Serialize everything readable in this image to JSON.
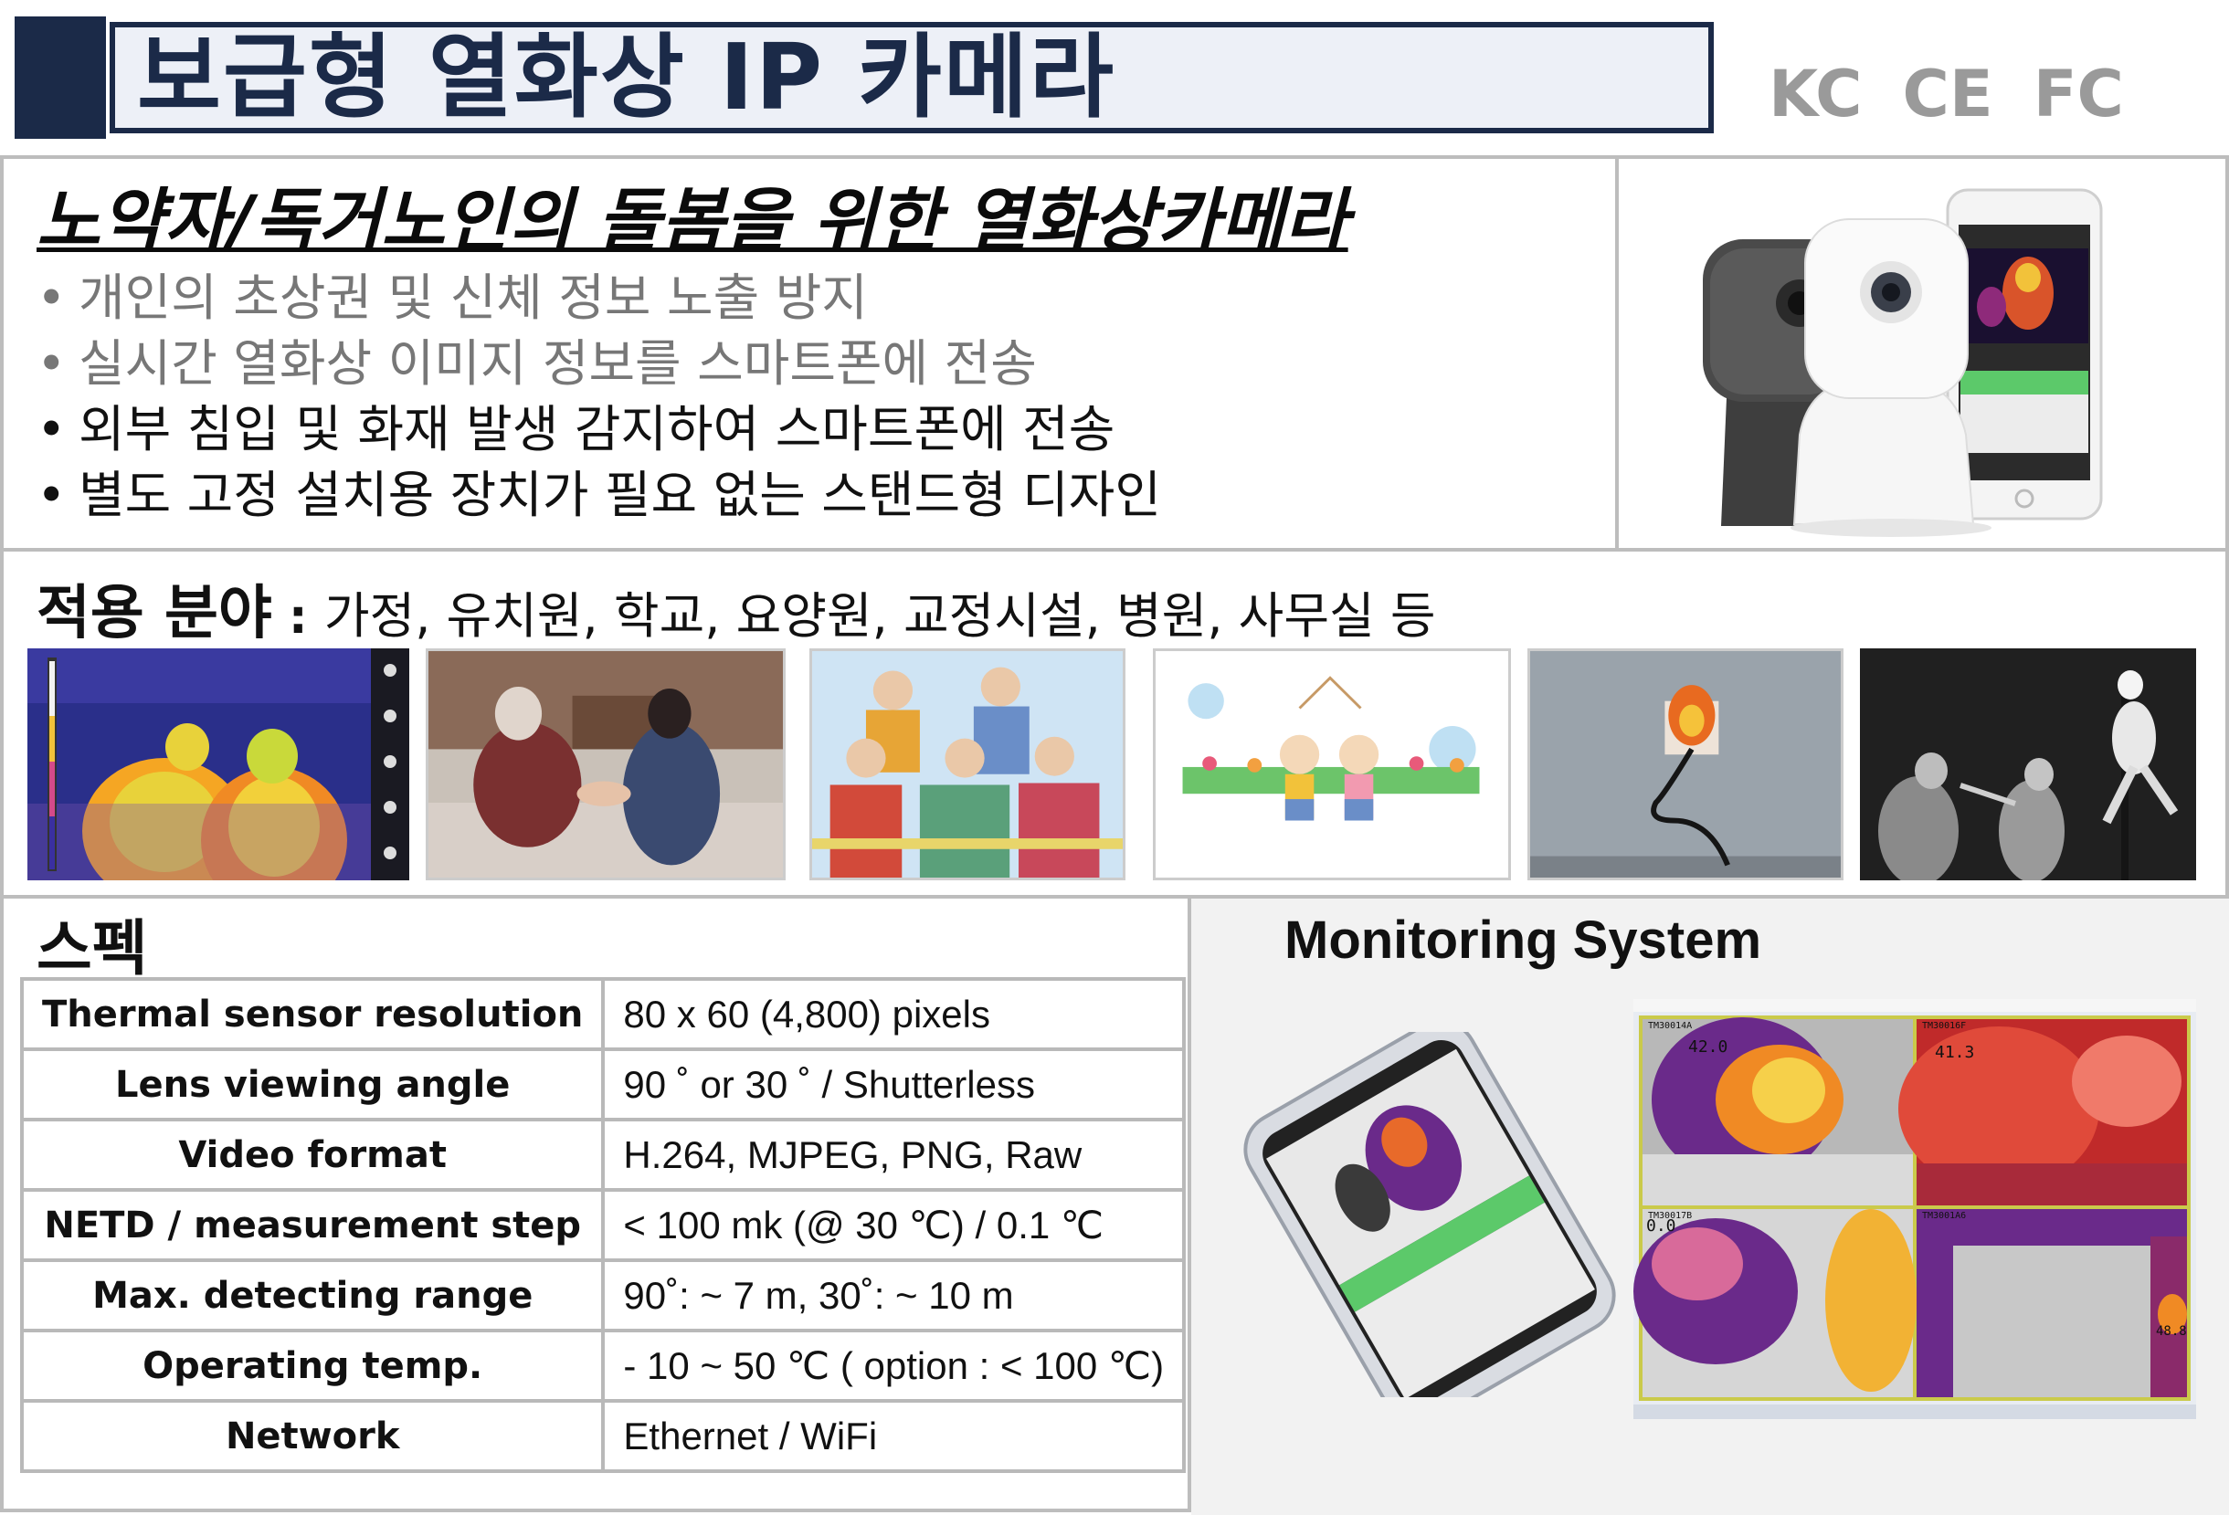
{
  "title": "보급형 열화상 IP 카메라",
  "certifications": [
    "KC",
    "CE",
    "FC"
  ],
  "headline": "노약자/독거노인의 돌봄을 위한 열화상카메라",
  "features": [
    {
      "text": "개인의 초상권 및 신체 정보 노출 방지",
      "tone": "gray"
    },
    {
      "text": "실시간 열화상 이미지 정보를 스마트폰에 전송",
      "tone": "gray"
    },
    {
      "text": "외부 침입  및 화재 발생 감지하여 스마트폰에 전송",
      "tone": "dark"
    },
    {
      "text": "별도 고정 설치용 장치가 필요 없는 스탠드형 디자인",
      "tone": "dark"
    }
  ],
  "fields": {
    "label": "적용 분야",
    "colon": " : ",
    "text": "가정, 유치원, 학교, 요양원, 교정시설, 병원, 사무실 등"
  },
  "spec": {
    "title": "스펙",
    "rows": [
      {
        "key": "Thermal sensor resolution",
        "value": "80 x 60 (4,800) pixels"
      },
      {
        "key": "Lens viewing angle",
        "value": "90 ˚ or  30 ˚  / Shutterless"
      },
      {
        "key": "Video format",
        "value": "H.264, MJPEG, PNG, Raw"
      },
      {
        "key": "NETD / measurement step",
        "value": "< 100 mk (@ 30 ℃) / 0.1 ℃"
      },
      {
        "key": "Max. detecting range",
        "value": "90˚:  ~ 7 m,   30˚:  ~ 10 m"
      },
      {
        "key": "Operating temp.",
        "value": "- 10  ~  50 ℃ ( option : < 100 ℃)"
      },
      {
        "key": "Network",
        "value": "Ethernet / WiFi"
      }
    ]
  },
  "monitoring": {
    "title": "Monitoring System",
    "cells": [
      {
        "label": "TM30014A",
        "temp": "42.0"
      },
      {
        "label": "TM30016F",
        "temp": "41.3"
      },
      {
        "label": "TM30017B",
        "temp": "0.0"
      },
      {
        "label": "TM3001A6",
        "temp": "48.8"
      }
    ]
  },
  "thumbnails": [
    {
      "name": "thermal-people"
    },
    {
      "name": "elderly-care"
    },
    {
      "name": "seniors-illustration"
    },
    {
      "name": "children-illustration"
    },
    {
      "name": "outlet-fire"
    },
    {
      "name": "thermal-intruders"
    }
  ],
  "colors": {
    "navy": "#1b2a48",
    "title_bg": "#edf0f7",
    "frame": "#bdbdbd",
    "panel_bg": "#f2f2f2",
    "app_green": "#5cc96a"
  }
}
